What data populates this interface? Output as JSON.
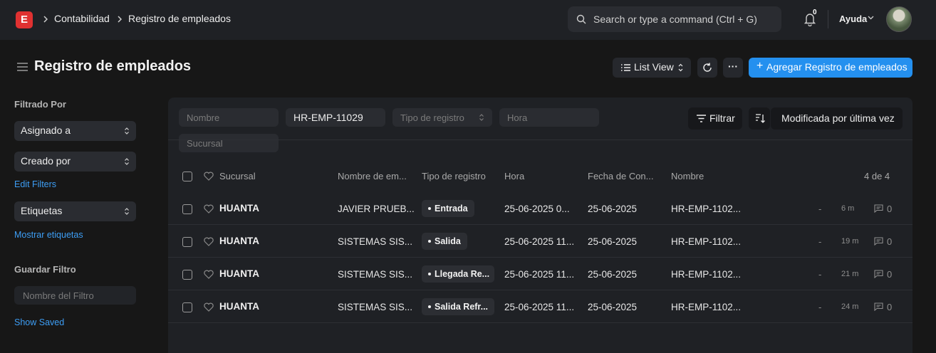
{
  "navbar": {
    "logo_letter": "E",
    "breadcrumbs": [
      "Contabilidad",
      "Registro de empleados"
    ],
    "search_placeholder": "Search or type a command (Ctrl + G)",
    "notification_count": "0",
    "help_label": "Ayuda"
  },
  "header": {
    "title": "Registro de empleados",
    "view_label": "List View",
    "more_label": "···",
    "primary_label": "Agregar Registro de empleados"
  },
  "sidebar": {
    "filtered_by": "Filtrado Por",
    "assigned_to": "Asignado a",
    "created_by": "Creado por",
    "edit_filters": "Edit Filters",
    "tags": "Etiquetas",
    "show_tags": "Mostrar etiquetas",
    "save_filter": "Guardar Filtro",
    "filter_name_placeholder": "Nombre del Filtro",
    "show_saved": "Show Saved"
  },
  "filters": {
    "nombre_placeholder": "Nombre",
    "id_value": "HR-EMP-11029",
    "tipo_placeholder": "Tipo de registro",
    "hora_placeholder": "Hora",
    "sucursal_placeholder": "Sucursal",
    "filter_button": "Filtrar",
    "sort_label": "Modificada por última vez"
  },
  "table": {
    "columns": [
      "Sucursal",
      "Nombre de em...",
      "Tipo de registro",
      "Hora",
      "Fecha de Con...",
      "Nombre"
    ],
    "count": "4 de 4",
    "rows": [
      {
        "sucursal": "HUANTA",
        "nombre_emp": "JAVIER PRUEB...",
        "tipo": "Entrada",
        "hora": "25-06-2025 0...",
        "fecha": "25-06-2025",
        "nombre": "HR-EMP-1102...",
        "dash": "-",
        "ago": "6 m",
        "comments": "0"
      },
      {
        "sucursal": "HUANTA",
        "nombre_emp": "SISTEMAS SIS...",
        "tipo": "Salida",
        "hora": "25-06-2025 11...",
        "fecha": "25-06-2025",
        "nombre": "HR-EMP-1102...",
        "dash": "-",
        "ago": "19 m",
        "comments": "0"
      },
      {
        "sucursal": "HUANTA",
        "nombre_emp": "SISTEMAS SIS...",
        "tipo": "Llegada Re...",
        "hora": "25-06-2025 11...",
        "fecha": "25-06-2025",
        "nombre": "HR-EMP-1102...",
        "dash": "-",
        "ago": "21 m",
        "comments": "0"
      },
      {
        "sucursal": "HUANTA",
        "nombre_emp": "SISTEMAS SIS...",
        "tipo": "Salida Refr...",
        "hora": "25-06-2025 11...",
        "fecha": "25-06-2025",
        "nombre": "HR-EMP-1102...",
        "dash": "-",
        "ago": "24 m",
        "comments": "0"
      }
    ]
  },
  "colors": {
    "accent": "#2490ef",
    "logo": "#e03131",
    "link": "#3d9ef5"
  }
}
